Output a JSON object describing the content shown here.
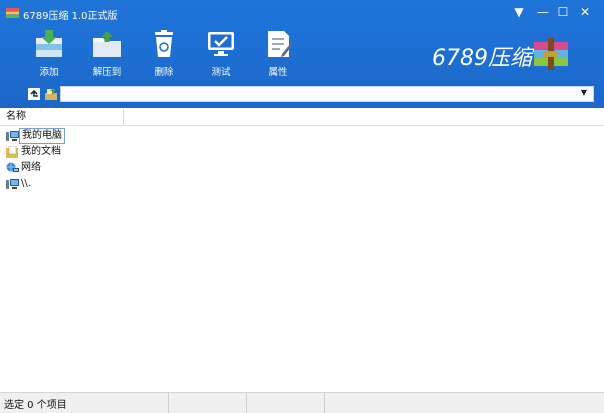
{
  "window": {
    "title": "6789压缩 1.0正式版",
    "controls": {
      "menu": "▼",
      "minimize": "—",
      "maximize": "☐",
      "close": "✕"
    }
  },
  "toolbar": {
    "items": [
      {
        "label": "添加",
        "icon": "add-archive-icon"
      },
      {
        "label": "解压到",
        "icon": "extract-to-icon"
      },
      {
        "label": "删除",
        "icon": "delete-icon"
      },
      {
        "label": "测试",
        "icon": "test-icon"
      },
      {
        "label": "属性",
        "icon": "properties-icon"
      }
    ]
  },
  "brand": {
    "name": "6789压缩",
    "logo": "archive-stack-logo"
  },
  "address": {
    "value": ""
  },
  "list": {
    "column_name": "名称",
    "items": [
      {
        "label": "我的电脑",
        "icon": "computer-icon",
        "selected": true
      },
      {
        "label": "我的文档",
        "icon": "documents-icon",
        "selected": false
      },
      {
        "label": "网络",
        "icon": "network-icon",
        "selected": false
      },
      {
        "label": "\\\\.",
        "icon": "computer-icon",
        "selected": false
      }
    ]
  },
  "status": {
    "text": "选定 0 个项目"
  },
  "colors": {
    "header_blue": "#1e6ed2",
    "status_bg": "#f0f0f0"
  }
}
